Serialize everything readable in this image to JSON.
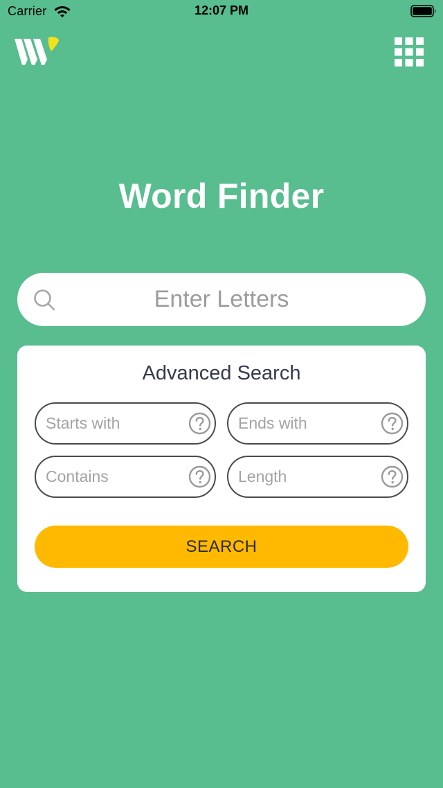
{
  "status_bar": {
    "carrier": "Carrier",
    "time": "12:07 PM"
  },
  "header": {
    "logo_icon": "word-finder-logo",
    "menu_icon": "grid-menu-icon"
  },
  "title": "Word Finder",
  "search": {
    "placeholder": "Enter Letters",
    "value": ""
  },
  "advanced": {
    "title": "Advanced Search",
    "fields": {
      "starts_with": {
        "placeholder": "Starts with",
        "value": ""
      },
      "ends_with": {
        "placeholder": "Ends with",
        "value": ""
      },
      "contains": {
        "placeholder": "Contains",
        "value": ""
      },
      "length": {
        "placeholder": "Length",
        "value": ""
      }
    },
    "button_label": "SEARCH"
  },
  "colors": {
    "background": "#58bd8f",
    "accent": "#ffb901",
    "logo_accent": "#f2e21d",
    "text_dark": "#343a4a"
  }
}
